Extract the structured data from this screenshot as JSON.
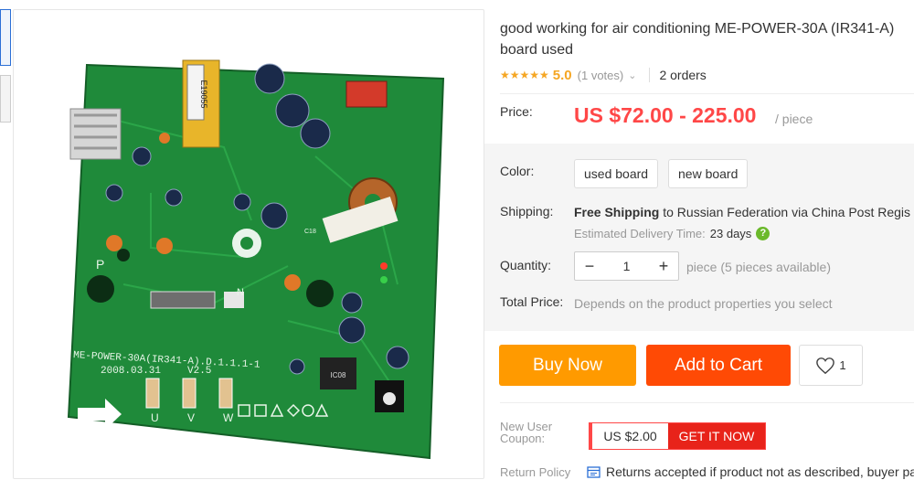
{
  "product": {
    "title_line1": "good working for air conditioning ME-POWER-30A (IR341-A)",
    "title_line2": "board used",
    "rating": {
      "stars": "★★★★★",
      "score": "5.0",
      "votes": "(1 votes)",
      "chevron": "⌄",
      "value": 5.0,
      "max": 5
    },
    "orders": "2 orders"
  },
  "photo": {
    "board_label_main": "ME-POWER-30A(IR341-A).D.1.1.1-1",
    "board_date": "2008.03.31",
    "board_version": "V2.5",
    "transformer_code": "E19055",
    "phase_labels": [
      "U",
      "V",
      "W"
    ],
    "pin_p": "P",
    "pin_n": "N",
    "chip_code": "IC08",
    "misc_code": "C18"
  },
  "price": {
    "label": "Price:",
    "value": "US $72.00 - 225.00",
    "unit": "/ piece"
  },
  "color": {
    "label": "Color:",
    "options": [
      "used board",
      "new board"
    ]
  },
  "shipping": {
    "label": "Shipping:",
    "free": "Free Shipping",
    "rest": " to Russian Federation via China Post Regis",
    "eta_label": "Estimated Delivery Time:",
    "eta_days": "23 days",
    "help_icon": "?"
  },
  "quantity": {
    "label": "Quantity:",
    "minus": "−",
    "value": "1",
    "plus": "+",
    "note": "piece (5 pieces available)"
  },
  "total": {
    "label": "Total Price:",
    "value": "Depends on the product properties you select"
  },
  "actions": {
    "buy": "Buy Now",
    "cart": "Add to Cart",
    "wish_count": "1"
  },
  "coupon": {
    "label": "New User Coupon:",
    "amount": "US $2.00",
    "cta": "GET IT NOW"
  },
  "returns": {
    "label": "Return Policy",
    "text": "Returns accepted if product not as described, buyer pa"
  },
  "colors": {
    "accent": "#ff4747",
    "buy": "#ff9a00",
    "cart": "#ff4a05",
    "star": "#f5a623",
    "pcb": "#1f8a3a"
  }
}
